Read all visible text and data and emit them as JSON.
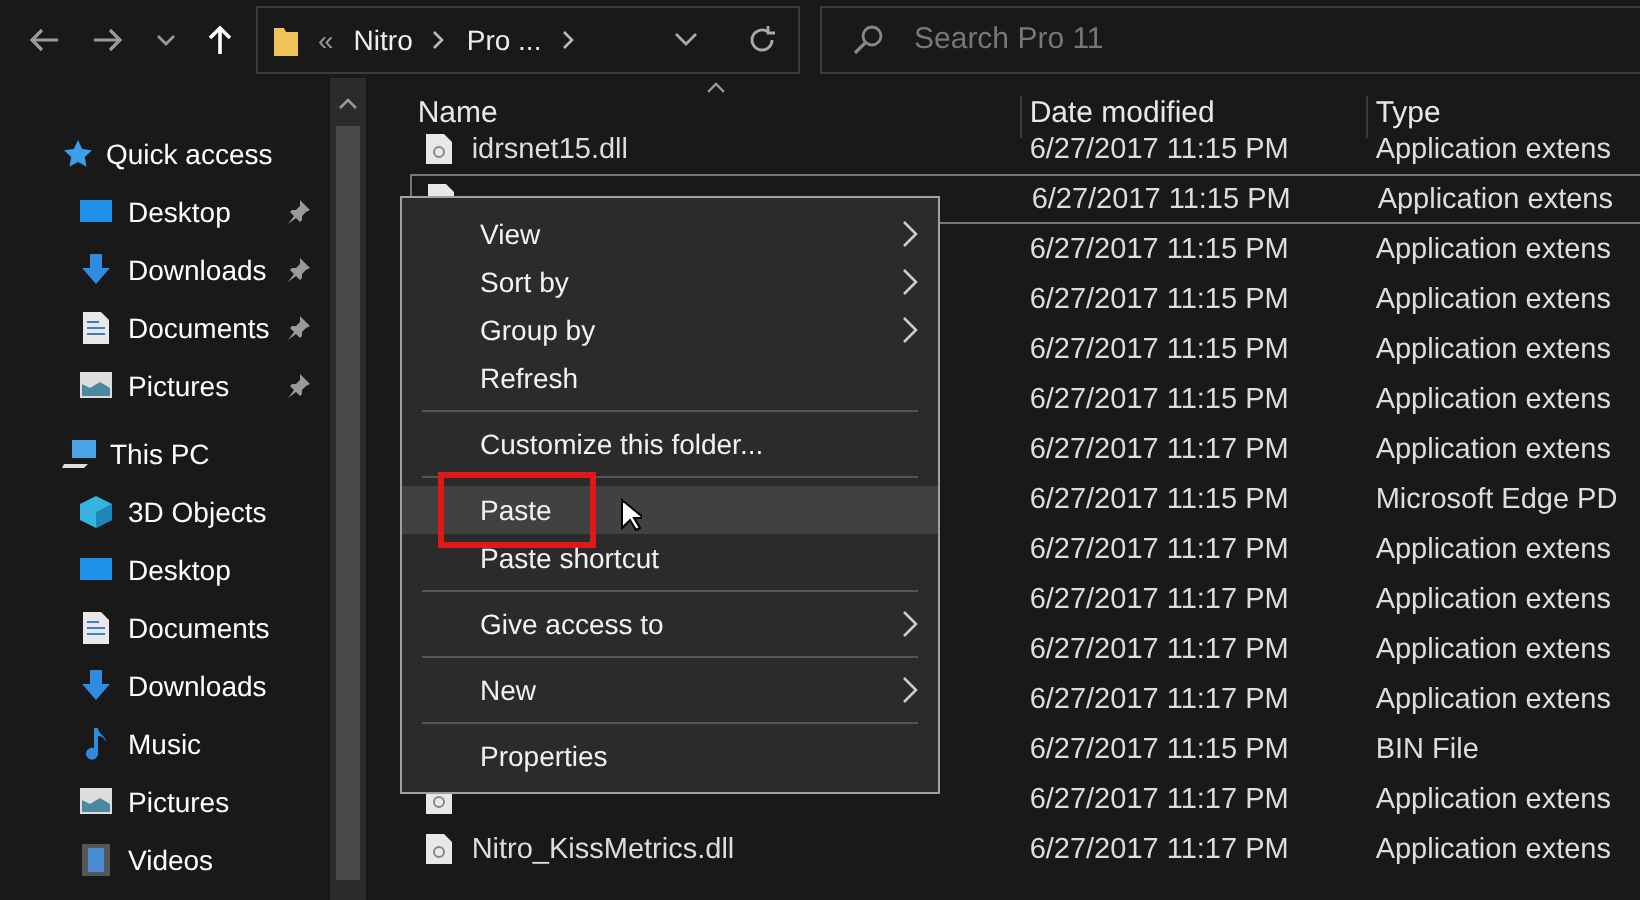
{
  "toolbar": {
    "address": {
      "separator": "«",
      "crumbs": [
        "Nitro",
        "Pro ..."
      ]
    },
    "search": {
      "placeholder": "Search Pro 11"
    }
  },
  "sidebar": {
    "groups": [
      {
        "label": "Quick access",
        "items": [
          {
            "label": "Desktop",
            "pinned": true
          },
          {
            "label": "Downloads",
            "pinned": true
          },
          {
            "label": "Documents",
            "pinned": true
          },
          {
            "label": "Pictures",
            "pinned": true
          }
        ]
      },
      {
        "label": "This PC",
        "items": [
          {
            "label": "3D Objects",
            "pinned": false
          },
          {
            "label": "Desktop",
            "pinned": false
          },
          {
            "label": "Documents",
            "pinned": false
          },
          {
            "label": "Downloads",
            "pinned": false
          },
          {
            "label": "Music",
            "pinned": false
          },
          {
            "label": "Pictures",
            "pinned": false
          },
          {
            "label": "Videos",
            "pinned": false
          }
        ]
      }
    ]
  },
  "table": {
    "columns": [
      "Name",
      "Date modified",
      "Type"
    ],
    "rows": [
      {
        "name": "idrsnet15.dll",
        "date": "6/27/2017 11:15 PM",
        "type": "Application extens",
        "selected": false
      },
      {
        "date": "6/27/2017 11:15 PM",
        "type": "Application extens",
        "selected": true
      },
      {
        "date": "6/27/2017 11:15 PM",
        "type": "Application extens",
        "selected": false
      },
      {
        "date": "6/27/2017 11:15 PM",
        "type": "Application extens",
        "selected": false
      },
      {
        "date": "6/27/2017 11:15 PM",
        "type": "Application extens",
        "selected": false
      },
      {
        "date": "6/27/2017 11:15 PM",
        "type": "Application extens",
        "selected": false
      },
      {
        "date": "6/27/2017 11:17 PM",
        "type": "Application extens",
        "selected": false
      },
      {
        "date": "6/27/2017 11:15 PM",
        "type": "Microsoft Edge PD",
        "selected": false
      },
      {
        "date": "6/27/2017 11:17 PM",
        "type": "Application extens",
        "selected": false
      },
      {
        "date": "6/27/2017 11:17 PM",
        "type": "Application extens",
        "selected": false
      },
      {
        "date": "6/27/2017 11:17 PM",
        "type": "Application extens",
        "selected": false
      },
      {
        "date": "6/27/2017 11:17 PM",
        "type": "Application extens",
        "selected": false
      },
      {
        "date": "6/27/2017 11:15 PM",
        "type": "BIN File",
        "selected": false
      },
      {
        "date": "6/27/2017 11:17 PM",
        "type": "Application extens",
        "selected": false
      },
      {
        "name": "Nitro_KissMetrics.dll",
        "date": "6/27/2017 11:17 PM",
        "type": "Application extens",
        "selected": false
      }
    ]
  },
  "context_menu": {
    "items": [
      {
        "kind": "item",
        "label": "View",
        "submenu": true,
        "hovered": false,
        "highlighted": false
      },
      {
        "kind": "item",
        "label": "Sort by",
        "submenu": true,
        "hovered": false,
        "highlighted": false
      },
      {
        "kind": "item",
        "label": "Group by",
        "submenu": true,
        "hovered": false,
        "highlighted": false
      },
      {
        "kind": "item",
        "label": "Refresh",
        "submenu": false,
        "hovered": false,
        "highlighted": false
      },
      {
        "kind": "separator"
      },
      {
        "kind": "item",
        "label": "Customize this folder...",
        "submenu": false,
        "hovered": false,
        "highlighted": false
      },
      {
        "kind": "separator"
      },
      {
        "kind": "item",
        "label": "Paste",
        "submenu": false,
        "hovered": true,
        "highlighted": true
      },
      {
        "kind": "item",
        "label": "Paste shortcut",
        "submenu": false,
        "hovered": false,
        "highlighted": false
      },
      {
        "kind": "separator"
      },
      {
        "kind": "item",
        "label": "Give access to",
        "submenu": true,
        "hovered": false,
        "highlighted": false
      },
      {
        "kind": "separator"
      },
      {
        "kind": "item",
        "label": "New",
        "submenu": true,
        "hovered": false,
        "highlighted": false
      },
      {
        "kind": "separator"
      },
      {
        "kind": "item",
        "label": "Properties",
        "submenu": false,
        "hovered": false,
        "highlighted": false
      }
    ]
  }
}
